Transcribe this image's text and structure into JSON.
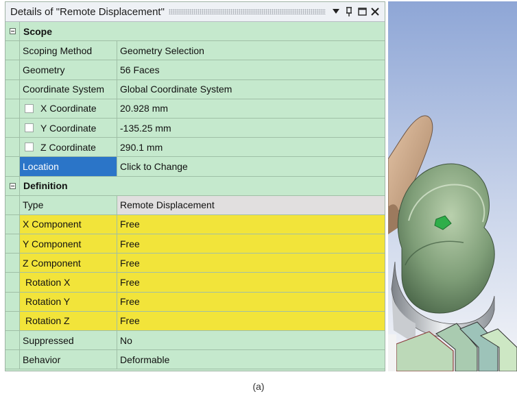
{
  "panel": {
    "title": "Details of \"Remote Displacement\"",
    "icons": [
      "dropdown-arrow-icon",
      "pin-icon",
      "maximize-icon",
      "close-icon"
    ]
  },
  "scope": {
    "label": "Scope",
    "rows": [
      {
        "name": "Scoping Method",
        "value": "Geometry Selection"
      },
      {
        "name": "Geometry",
        "value": "56 Faces"
      },
      {
        "name": "Coordinate System",
        "value": "Global Coordinate System"
      },
      {
        "name": "X Coordinate",
        "value": "20.928 mm"
      },
      {
        "name": "Y Coordinate",
        "value": "-135.25 mm"
      },
      {
        "name": "Z Coordinate",
        "value": "290.1 mm"
      },
      {
        "name": "Location",
        "value": "Click to Change"
      }
    ]
  },
  "definition": {
    "label": "Definition",
    "rows": [
      {
        "name": "Type",
        "value": "Remote Displacement"
      },
      {
        "name": "X Component",
        "value": "Free"
      },
      {
        "name": "Y Component",
        "value": "Free"
      },
      {
        "name": "Z Component",
        "value": "Free"
      },
      {
        "name": "Rotation X",
        "value": "Free"
      },
      {
        "name": "Rotation Y",
        "value": "Free"
      },
      {
        "name": "Rotation Z",
        "value": "Free"
      },
      {
        "name": "Suppressed",
        "value": "No"
      },
      {
        "name": "Behavior",
        "value": "Deformable"
      }
    ]
  },
  "caption": "(a)",
  "colors": {
    "panel_bg": "#c5e9cd",
    "required_field": "#f2e43a",
    "selection": "#2b75c8",
    "readonly_field": "#e1dfdf"
  }
}
